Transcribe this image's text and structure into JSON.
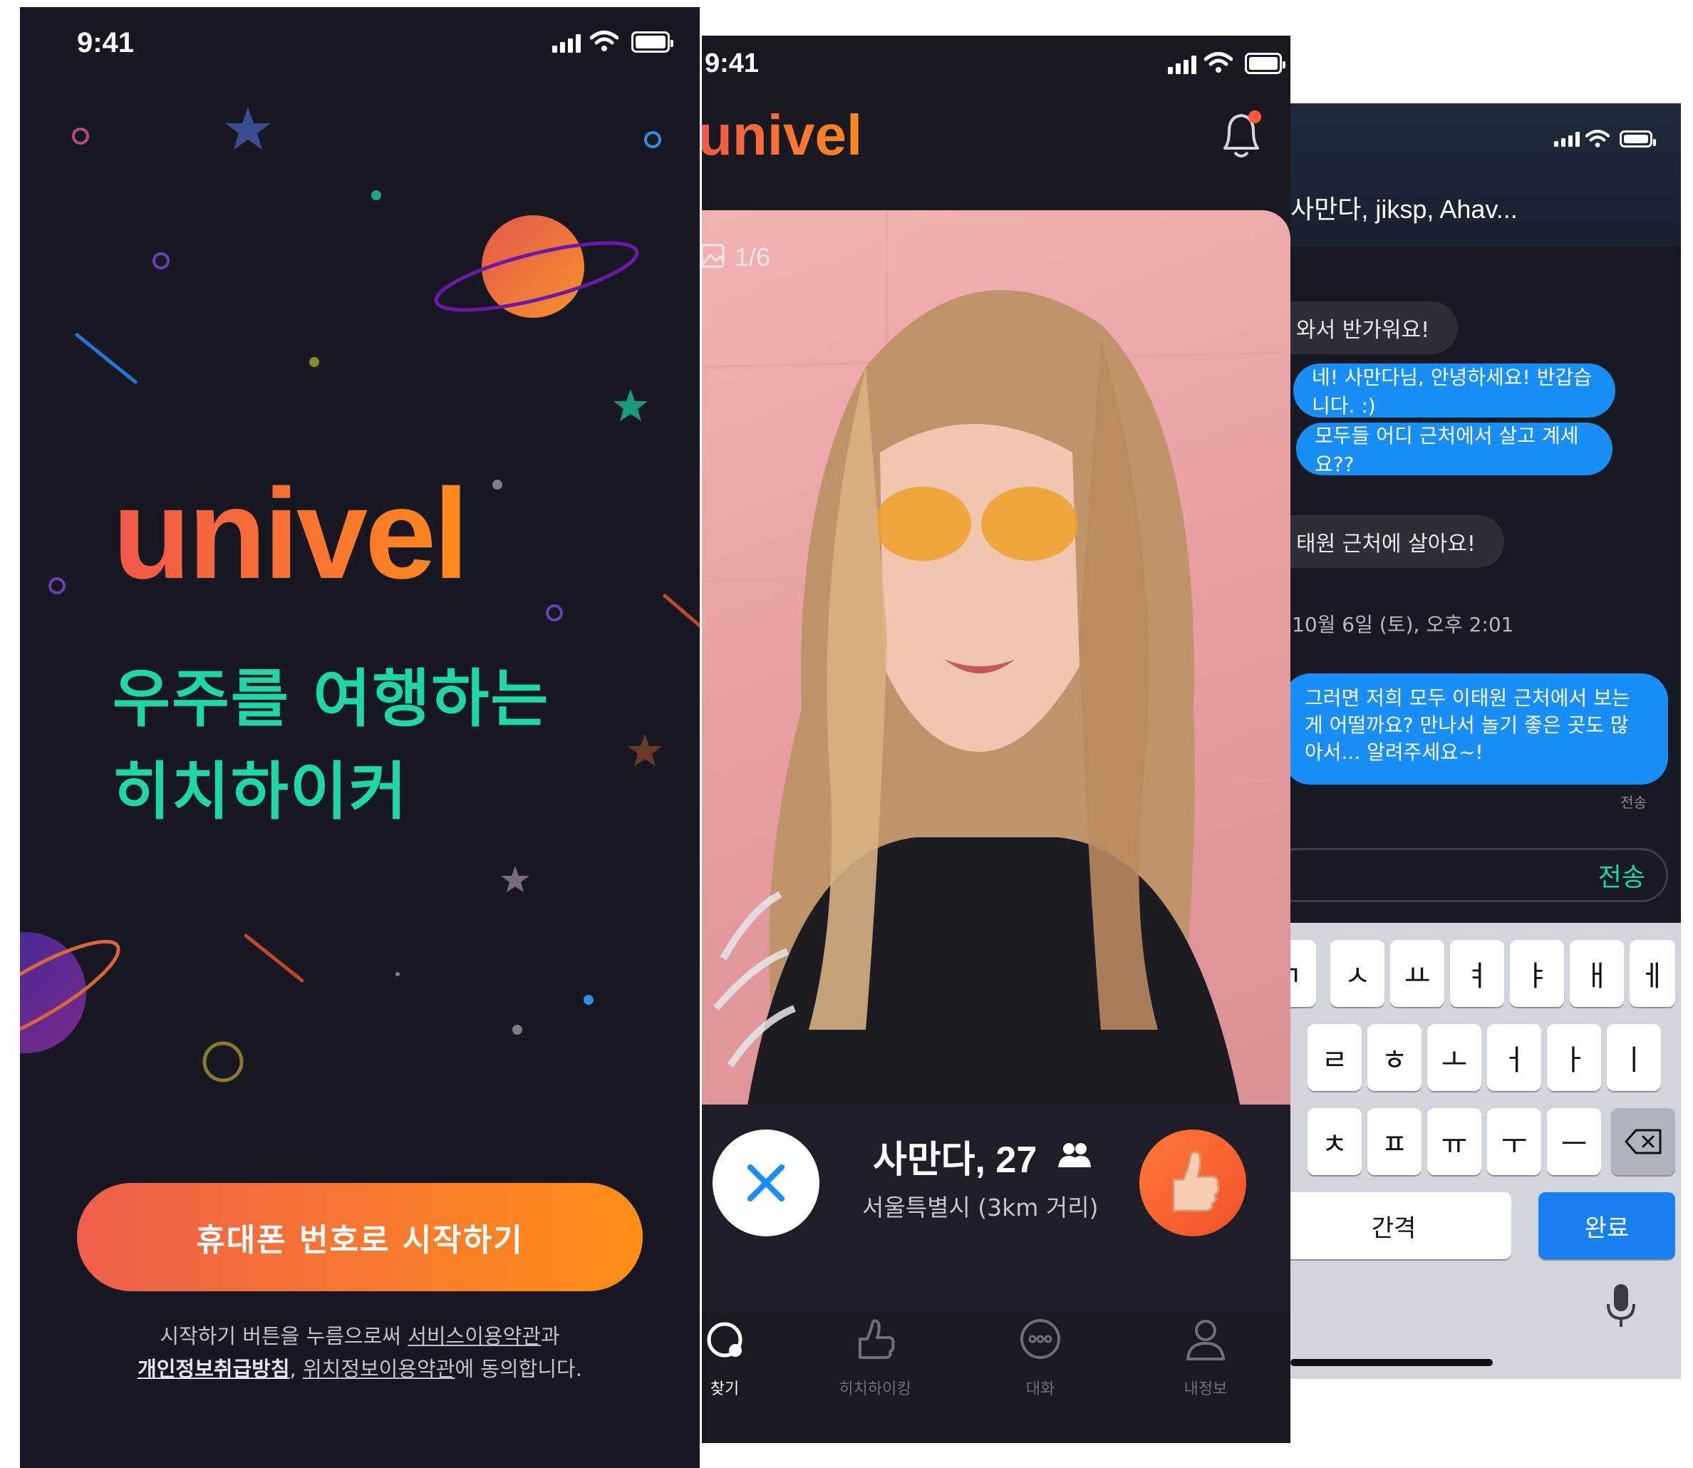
{
  "status_bar": {
    "time": "9:41"
  },
  "splash": {
    "logo": "univel",
    "tagline_line1": "우주를 여행하는",
    "tagline_line2": "히치하이커",
    "start_button": "휴대폰 번호로 시작하기",
    "terms": {
      "pre": "시작하기 버튼을 누름으로써 ",
      "service_terms": "서비스이용약관",
      "and": "과",
      "privacy": "개인정보취급방침",
      "comma": ", ",
      "location_terms": "위치정보이용약관",
      "post": "에 동의합니다."
    }
  },
  "discover": {
    "logo": "univel",
    "photo_counter": "1/6",
    "profile_name": "사만다, 27",
    "profile_location": "서울특별시 (3km 거리)",
    "tabs": [
      {
        "label": "찾기",
        "icon": "planet-icon"
      },
      {
        "label": "히치하이킹",
        "icon": "thumbs-up-icon"
      },
      {
        "label": "대화",
        "icon": "chat-bubble-icon"
      },
      {
        "label": "내정보",
        "icon": "person-icon"
      }
    ],
    "colors": {
      "accent_start": "#f0584a",
      "accent_end": "#ff8a1d",
      "pass": "#1a8ef7"
    }
  },
  "chat": {
    "title": "사만다, jiksp, Ahav...",
    "messages": [
      {
        "dir": "in",
        "text": "와서 반가워요!"
      },
      {
        "dir": "out",
        "text": "네! 사만다님, 안녕하세요! 반갑습니다. :)"
      },
      {
        "dir": "out",
        "text": "모두들 어디 근처에서 살고 계세요??"
      },
      {
        "dir": "in",
        "text": "태원 근처에 살아요!"
      },
      {
        "dir": "out",
        "text": "그러면 저희 모두 이태원 근처에서 보는게 어떨까요? 만나서 놀기 좋은 곳도 많아서... 알려주세요~!"
      }
    ],
    "date_label": "10월 6일 (토), 오후 2:01",
    "sent_label": "전송",
    "send_button": "전송",
    "keyboard": {
      "row1": [
        "ㄱ",
        "ㅅ",
        "ㅛ",
        "ㅕ",
        "ㅑ",
        "ㅐ",
        "ㅔ"
      ],
      "row2": [
        "ㄹ",
        "ㅎ",
        "ㅗ",
        "ㅓ",
        "ㅏ",
        "ㅣ"
      ],
      "row3": [
        "ㅊ",
        "ㅍ",
        "ㅠ",
        "ㅜ",
        "ㅡ"
      ],
      "space": "간격",
      "done": "완료"
    }
  }
}
